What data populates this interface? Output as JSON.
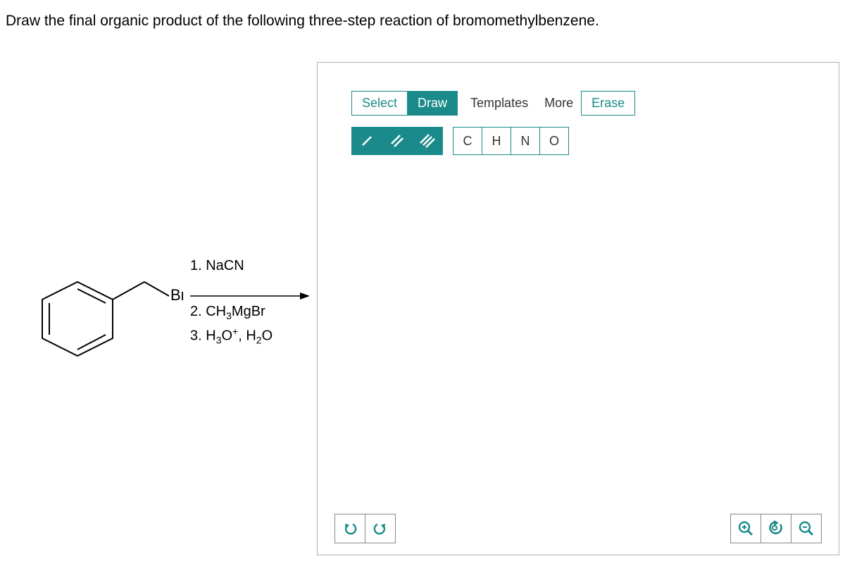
{
  "question": "Draw the final organic product of the following three-step reaction of bromomethylbenzene.",
  "br_label": "Br",
  "reagents": {
    "r1": "1. NaCN",
    "r2_pre": "2. CH",
    "r2_sub": "3",
    "r2_post": "MgBr",
    "r3_pre": "3. H",
    "r3_sub1": "3",
    "r3_mid": "O",
    "r3_sup": "+",
    "r3_mid2": ", H",
    "r3_sub2": "2",
    "r3_post": "O"
  },
  "toolbar": {
    "select": "Select",
    "draw": "Draw",
    "templates": "Templates",
    "more": "More",
    "erase": "Erase"
  },
  "elements": {
    "c": "C",
    "h": "H",
    "n": "N",
    "o": "O"
  },
  "icons": {
    "single_bond": "single-bond-icon",
    "double_bond": "double-bond-icon",
    "triple_bond": "triple-bond-icon",
    "undo": "undo-icon",
    "redo": "redo-icon",
    "zoom_in": "zoom-in-icon",
    "reset_zoom": "reset-zoom-icon",
    "zoom_out": "zoom-out-icon"
  }
}
